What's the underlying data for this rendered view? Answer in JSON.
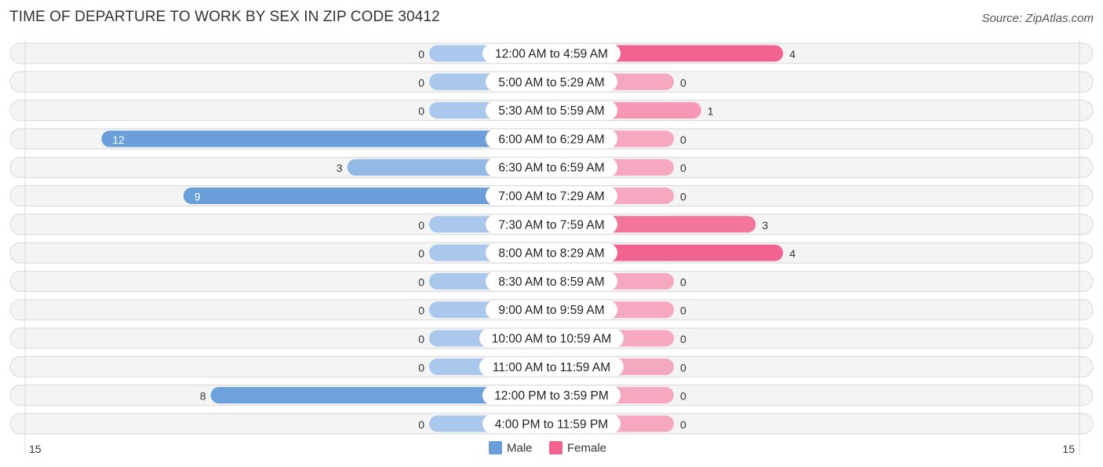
{
  "title": "TIME OF DEPARTURE TO WORK BY SEX IN ZIP CODE 30412",
  "source": "Source: ZipAtlas.com",
  "chart_data": {
    "type": "bar",
    "orientation": "horizontal-diverging",
    "title": "TIME OF DEPARTURE TO WORK BY SEX IN ZIP CODE 30412",
    "categories": [
      "12:00 AM to 4:59 AM",
      "5:00 AM to 5:29 AM",
      "5:30 AM to 5:59 AM",
      "6:00 AM to 6:29 AM",
      "6:30 AM to 6:59 AM",
      "7:00 AM to 7:29 AM",
      "7:30 AM to 7:59 AM",
      "8:00 AM to 8:29 AM",
      "8:30 AM to 8:59 AM",
      "9:00 AM to 9:59 AM",
      "10:00 AM to 10:59 AM",
      "11:00 AM to 11:59 AM",
      "12:00 PM to 3:59 PM",
      "4:00 PM to 11:59 PM"
    ],
    "series": [
      {
        "name": "Male",
        "color": "#6a9fdc",
        "color_light": "#a9c8ec",
        "side": "left",
        "values": [
          0,
          0,
          0,
          12,
          3,
          9,
          0,
          0,
          0,
          0,
          0,
          0,
          8,
          0
        ]
      },
      {
        "name": "Female",
        "color": "#f0648f",
        "color_light": "#f7a8c1",
        "side": "right",
        "values": [
          4,
          0,
          1,
          0,
          0,
          0,
          3,
          4,
          0,
          0,
          0,
          0,
          0,
          0
        ]
      }
    ],
    "axis": {
      "left_tick": "15",
      "right_tick": "15",
      "range": [
        -15,
        15
      ]
    },
    "legend": {
      "position": "bottom-center",
      "items": [
        "Male",
        "Female"
      ]
    },
    "xlabel": "",
    "ylabel": ""
  }
}
